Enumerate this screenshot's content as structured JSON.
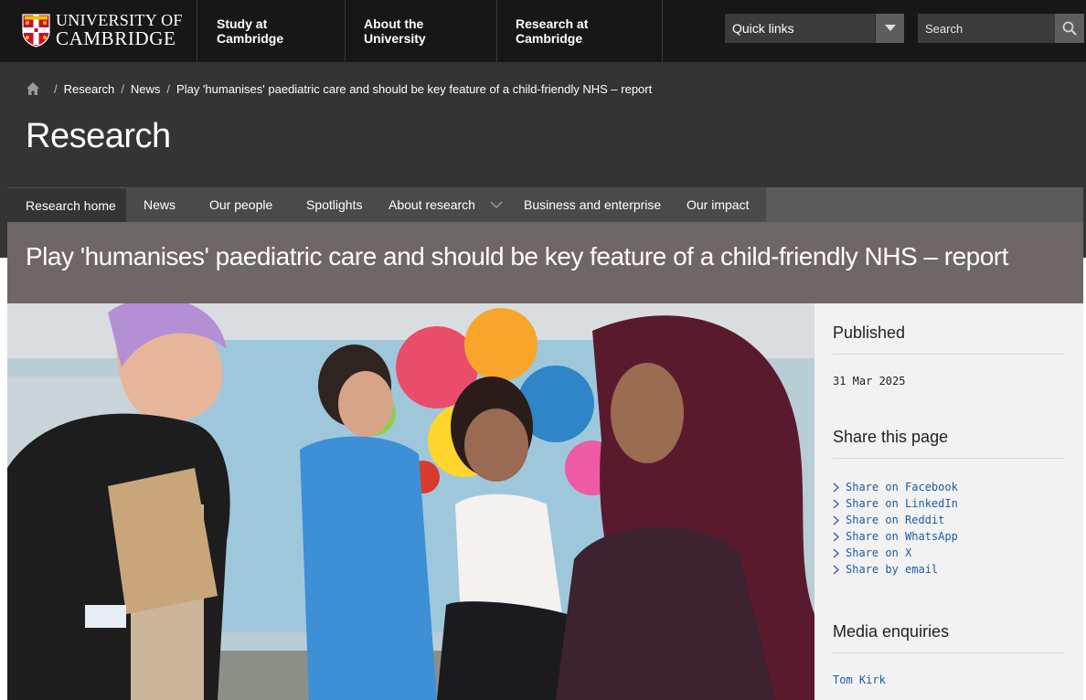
{
  "header": {
    "logo": {
      "line1": "UNIVERSITY OF",
      "line2": "CAMBRIDGE"
    },
    "nav": [
      "Study at Cambridge",
      "About the University",
      "Research at Cambridge"
    ],
    "quick_links": {
      "label": "Quick links"
    },
    "search": {
      "placeholder": "Search"
    }
  },
  "breadcrumb": [
    "Research",
    "News",
    "Play 'humanises' paediatric care and should be key feature of a child-friendly NHS – report"
  ],
  "section_title": "Research",
  "section_nav": {
    "items": [
      "Research home",
      "News",
      "Our people",
      "Spotlights",
      "About research",
      "Business and enterprise",
      "Our impact"
    ],
    "active": "Research home"
  },
  "article": {
    "title": "Play 'humanises' paediatric care and should be key feature of a child-friendly NHS – report"
  },
  "sidebar": {
    "published_heading": "Published",
    "published_date": "31 Mar 2025",
    "share_heading": "Share this page",
    "share_links": [
      "Share on Facebook",
      "Share on LinkedIn",
      "Share on Reddit",
      "Share on WhatsApp",
      "Share on X",
      "Share by email"
    ],
    "media_heading": "Media enquiries",
    "media_contact": "Tom Kirk"
  },
  "colors": {
    "topbar": "#171717",
    "header_band": "#343434",
    "title_bar": "#6f6766",
    "link": "#1d5c9f",
    "sidebar_bg": "#f2f2f2"
  },
  "icons": {
    "home": "home-icon",
    "dropdown": "chevron-down-icon",
    "search": "search-icon",
    "share_bullet": "chevron-right-icon"
  }
}
